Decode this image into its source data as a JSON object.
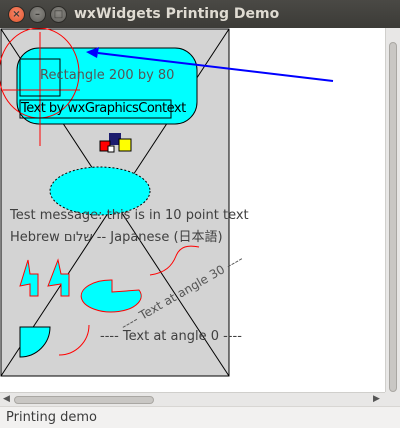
{
  "window": {
    "title": "wxWidgets Printing Demo",
    "close_glyph": "×",
    "min_glyph": "–",
    "max_glyph": "□"
  },
  "canvas": {
    "rect_label": "Rectangle 200 by 80",
    "graphics_context_label": "Text by wxGraphicsContext",
    "message_10pt": "Test message: this is in 10 point text",
    "multilang": "Hebrew    שלום -- Japanese (日本語)",
    "text_angle_30": "---- Text at angle 30 ----",
    "text_angle_0": "---- Text at angle 0 ----",
    "colors": {
      "cyan": "#00ffff",
      "red": "#ff0000",
      "blue": "#0000ff",
      "yellow": "#ffff00",
      "navy": "#1c1c6e",
      "paper": "#d3d3d3"
    }
  },
  "statusbar": {
    "text": "Printing demo"
  },
  "icons": {
    "vscroll_up": "scroll-up-arrow-icon",
    "hscroll_left": "scroll-left-arrow-icon",
    "hscroll_right": "scroll-right-arrow-icon"
  }
}
